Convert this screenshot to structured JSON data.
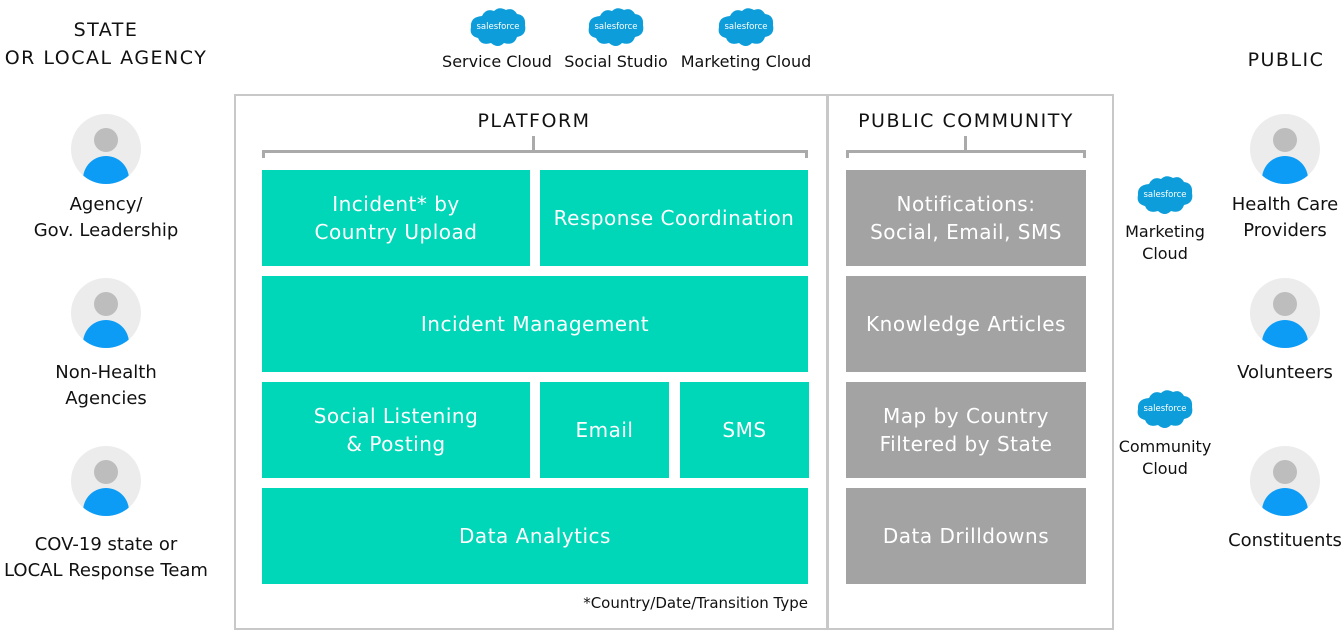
{
  "left_column": {
    "heading_line1": "STATE",
    "heading_line2": "OR LOCAL AGENCY",
    "people": [
      {
        "line1": "Agency/",
        "line2": "Gov. Leadership",
        "icon": "person-avatar-icon"
      },
      {
        "line1": "Non-Health",
        "line2": "Agencies",
        "icon": "person-avatar-icon"
      },
      {
        "line1": "COV-19 state or",
        "line2": "LOCAL Response Team",
        "icon": "person-avatar-icon"
      }
    ]
  },
  "top_products": [
    {
      "logo_text": "salesforce",
      "label": "Service Cloud"
    },
    {
      "logo_text": "salesforce",
      "label": "Social Studio"
    },
    {
      "logo_text": "salesforce",
      "label": "Marketing Cloud"
    }
  ],
  "platform": {
    "title": "PLATFORM",
    "tiles": {
      "incident_upload_line1": "Incident* by",
      "incident_upload_line2": "Country Upload",
      "response_coordination": "Response Coordination",
      "incident_management": "Incident Management",
      "social_line1": "Social Listening",
      "social_line2": "& Posting",
      "email": "Email",
      "sms": "SMS",
      "data_analytics": "Data Analytics"
    },
    "footnote": "*Country/Date/Transition Type",
    "color": "#00d7b9"
  },
  "public_community": {
    "title": "PUBLIC COMMUNITY",
    "tiles": {
      "notifications_line1": "Notifications:",
      "notifications_line2": "Social, Email, SMS",
      "knowledge_articles": "Knowledge Articles",
      "map_line1": "Map by Country",
      "map_line2": "Filtered by State",
      "data_drilldowns": "Data Drilldowns"
    },
    "color": "#a3a3a3"
  },
  "side_products": [
    {
      "logo_text": "salesforce",
      "line1": "Marketing",
      "line2": "Cloud"
    },
    {
      "logo_text": "salesforce",
      "line1": "Community",
      "line2": "Cloud"
    }
  ],
  "right_column": {
    "heading": "PUBLIC",
    "people": [
      {
        "line1": "Health Care",
        "line2": "Providers",
        "icon": "person-avatar-icon"
      },
      {
        "line1": "Volunteers",
        "line2": "",
        "icon": "person-avatar-icon"
      },
      {
        "line1": "Constituents",
        "line2": "",
        "icon": "person-avatar-icon"
      }
    ]
  },
  "colors": {
    "salesforce_blue": "#0d9dda",
    "avatar_body": "#0d9cf5",
    "frame": "#c8c8c8"
  }
}
